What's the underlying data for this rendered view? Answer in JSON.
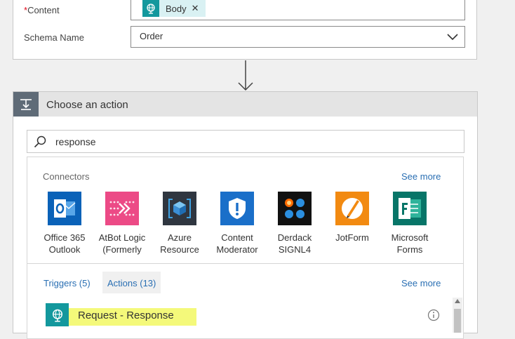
{
  "previous_action": {
    "content_label": "Content",
    "required_marker": "*",
    "content_token": {
      "label": "Body",
      "icon": "globe-request-icon"
    },
    "schema_label": "Schema Name",
    "schema_value": "Order"
  },
  "choose_action": {
    "title": "Choose an action",
    "search": {
      "value": "response"
    },
    "connectors": {
      "heading": "Connectors",
      "see_more": "See more",
      "items": [
        {
          "line1": "Office 365",
          "line2": "Outlook",
          "color": "#0a62b8"
        },
        {
          "line1": "AtBot Logic",
          "line2": "(Formerly",
          "color": "#ec4a86"
        },
        {
          "line1": "Azure",
          "line2": "Resource",
          "color": "#2f3640"
        },
        {
          "line1": "Content",
          "line2": "Moderator",
          "color": "#1a6fc9"
        },
        {
          "line1": "Derdack",
          "line2": "SIGNL4",
          "color": "#111111"
        },
        {
          "line1": "JotForm",
          "line2": "",
          "color": "#f28a11"
        },
        {
          "line1": "Microsoft",
          "line2": "Forms",
          "color": "#077568"
        }
      ]
    },
    "tabs": {
      "triggers": "Triggers (5)",
      "actions": "Actions (13)",
      "see_more": "See more"
    },
    "results": [
      {
        "label": "Request - Response",
        "icon": "globe-request-icon"
      }
    ],
    "colors": {
      "accent": "#2a6fb3",
      "header_bg": "#e4e4e4",
      "highlight": "#f4f97a",
      "request_icon_bg": "#13989d"
    }
  }
}
